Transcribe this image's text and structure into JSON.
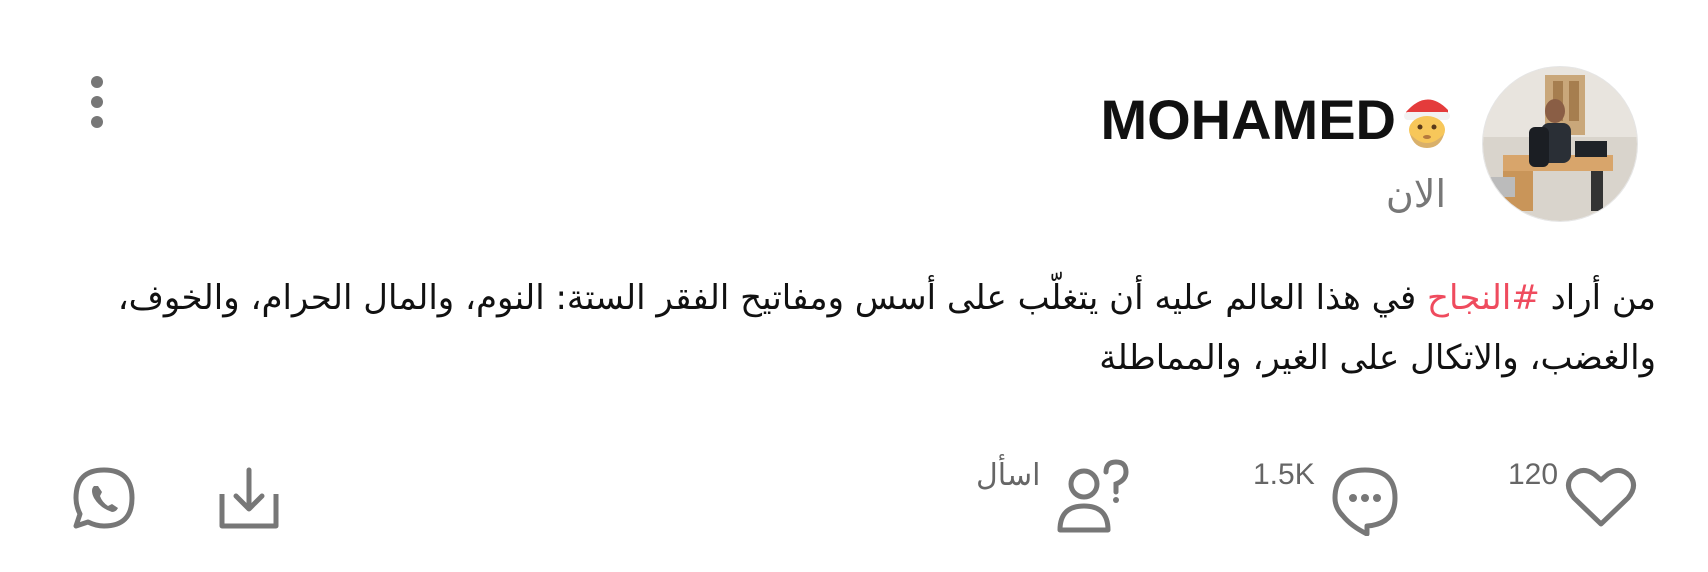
{
  "post": {
    "author": {
      "name": "MOHAMED",
      "badge_icon": "santa-emoji-icon",
      "avatar": "profile-photo"
    },
    "timestamp": "الان",
    "text_before": "من أراد ",
    "hashtag": "#النجاح",
    "text_after": " في هذا العالم عليه أن يتغلّب على أسس ومفاتيح الفقر الستة: النوم، والمال الحرام، والخوف، والغضب، والاتكال على الغير، والمماطلة",
    "hashtag_color": "#ef4b5e"
  },
  "actions": {
    "like": {
      "icon": "heart-icon",
      "count": "120"
    },
    "comment": {
      "icon": "comment-bubble-icon",
      "count": "1.5K"
    },
    "ask": {
      "icon": "ask-person-icon",
      "label": "اسأل"
    },
    "download": {
      "icon": "download-icon"
    },
    "share": {
      "icon": "whatsapp-icon"
    }
  },
  "menu": {
    "icon": "more-vertical-icon"
  }
}
